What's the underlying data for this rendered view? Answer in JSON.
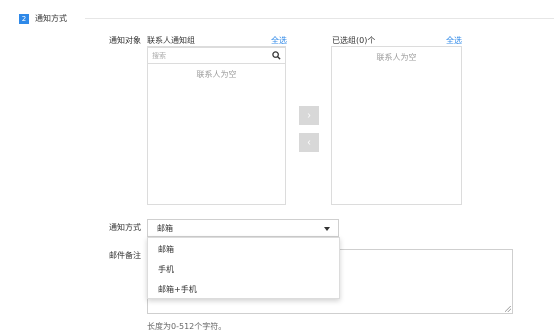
{
  "section": {
    "number": "2",
    "title": "通知方式"
  },
  "notify_target": {
    "label": "通知对象",
    "left_panel": {
      "title": "联系人通知组",
      "select_all": "全选",
      "search_placeholder": "搜索",
      "empty": "联系人为空"
    },
    "right_panel": {
      "title": "已选组(0)个",
      "select_all": "全选",
      "empty": "联系人为空"
    },
    "move_right": "›",
    "move_left": "‹"
  },
  "notify_method": {
    "label": "通知方式",
    "selected": "邮箱",
    "options": [
      "邮箱",
      "手机",
      "邮箱+手机"
    ]
  },
  "email_note": {
    "label": "邮件备注",
    "value": "",
    "hint": "长度为0-512个字符。"
  }
}
